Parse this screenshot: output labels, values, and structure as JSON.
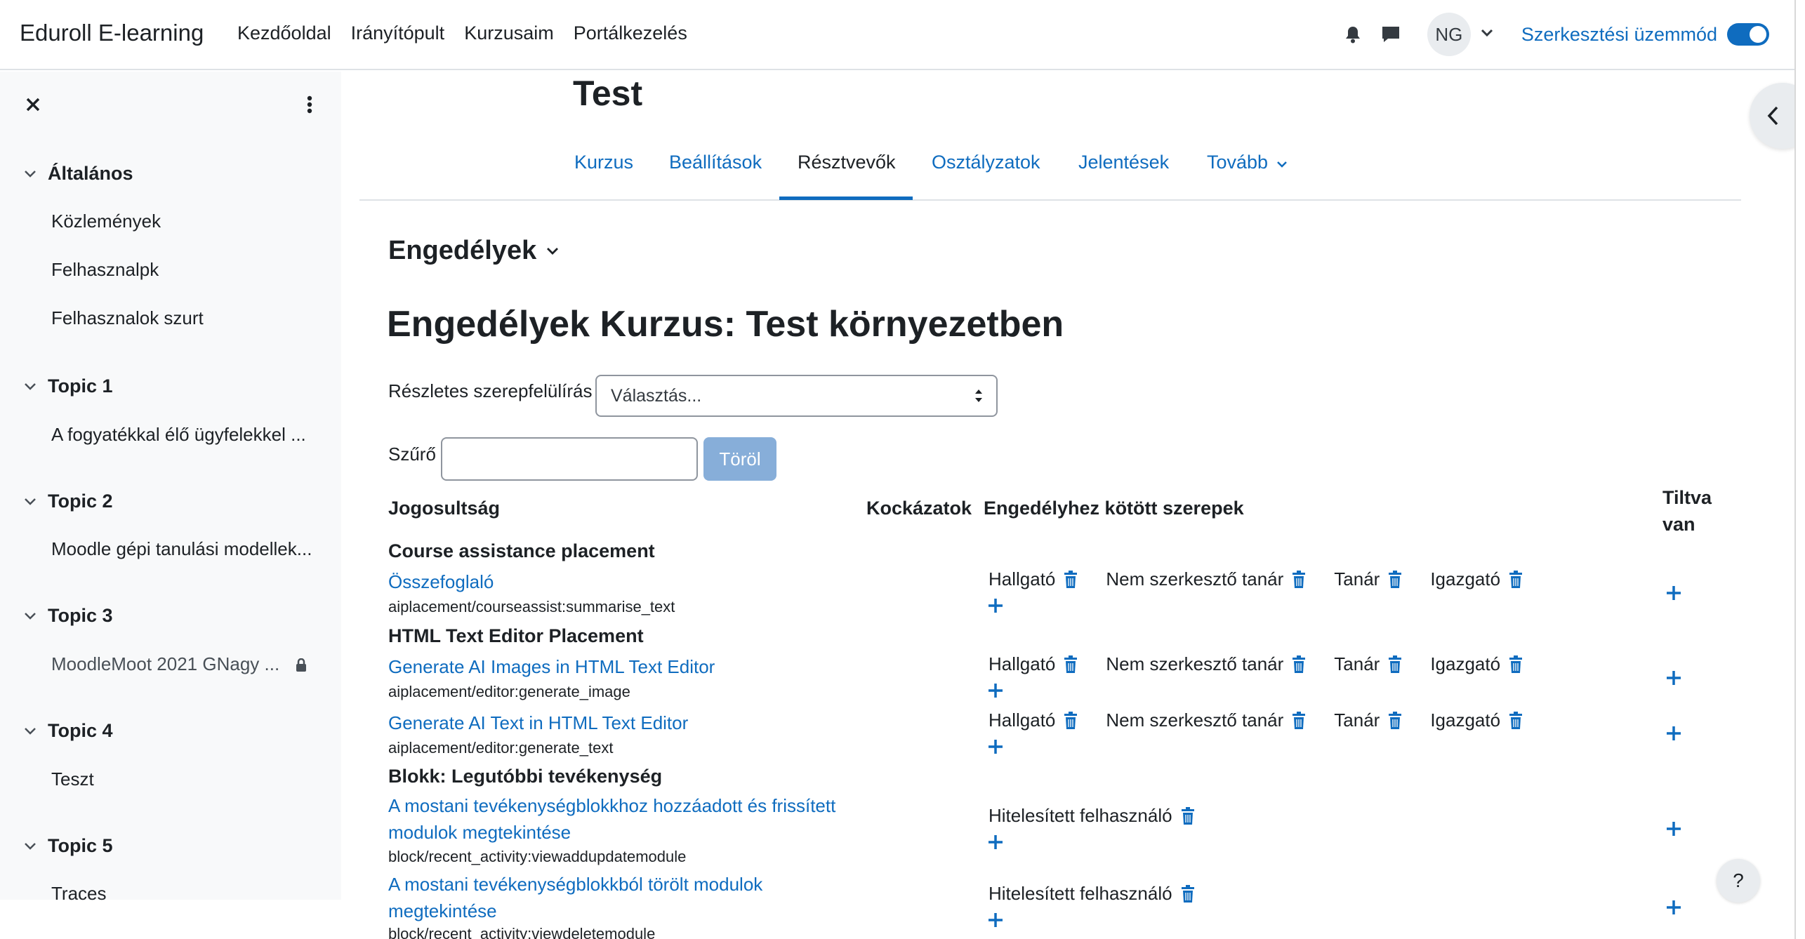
{
  "navbar": {
    "brand": "Eduroll E-learning",
    "links": [
      "Kezdőoldal",
      "Irányítópult",
      "Kurzusaim",
      "Portálkezelés"
    ],
    "user_initials": "NG",
    "edit_mode_label": "Szerkesztési üzemmód",
    "edit_mode_on": true
  },
  "drawer": {
    "sections": [
      {
        "title": "Általános",
        "items": [
          "Közlemények",
          "Felhasznalpk",
          "Felhasznalok szurt"
        ]
      },
      {
        "title": "Topic 1",
        "items": [
          "A fogyatékkal élő ügyfelekkel ..."
        ]
      },
      {
        "title": "Topic 2",
        "items": [
          "Moodle gépi tanulási modellek..."
        ]
      },
      {
        "title": "Topic 3",
        "items": [
          "MoodleMoot 2021 GNagy ..."
        ]
      },
      {
        "title": "Topic 4",
        "items": [
          "Teszt"
        ]
      },
      {
        "title": "Topic 5",
        "items": [
          "Traces"
        ]
      }
    ]
  },
  "course": {
    "title": "Test",
    "tabs": [
      "Kurzus",
      "Beállítások",
      "Résztvevők",
      "Osztályzatok",
      "Jelentések",
      "Tovább"
    ],
    "active_tab": "Résztvevők"
  },
  "permissions": {
    "menu_title": "Engedélyek",
    "heading": "Engedélyek Kurzus: Test környezetben",
    "advanced_override_label": "Részletes szerepfelülírás",
    "select_value": "Választás...",
    "filter_label": "Szűrő",
    "clear_button": "Töröl",
    "columns": {
      "capability": "Jogosultság",
      "risks": "Kockázatok",
      "roles": "Engedélyhez kötött szerepek",
      "prohibited_line1": "Tiltva",
      "prohibited_line2": "van"
    },
    "groups": [
      {
        "name": "Course assistance placement"
      },
      {
        "name": "HTML Text Editor Placement"
      },
      {
        "name": "Blokk: Legutóbbi tevékenység"
      }
    ],
    "rows": [
      {
        "title": "Összefoglaló",
        "code": "aiplacement/courseassist:summarise_text",
        "roles": [
          "Hallgató",
          "Nem szerkesztő tanár",
          "Tanár",
          "Igazgató"
        ]
      },
      {
        "title": "Generate AI Images in HTML Text Editor",
        "code": "aiplacement/editor:generate_image",
        "roles": [
          "Hallgató",
          "Nem szerkesztő tanár",
          "Tanár",
          "Igazgató"
        ]
      },
      {
        "title": "Generate AI Text in HTML Text Editor",
        "code": "aiplacement/editor:generate_text",
        "roles": [
          "Hallgató",
          "Nem szerkesztő tanár",
          "Tanár",
          "Igazgató"
        ]
      },
      {
        "title": "A mostani tevékenységblokkhoz hozzáadott és frissített modulok megtekintése",
        "code": "block/recent_activity:viewaddupdatemodule",
        "roles": [
          "Hitelesített felhasználó"
        ]
      },
      {
        "title": "A mostani tevékenységblokkból törölt modulok megtekintése",
        "code": "block/recent_activity:viewdeletemodule",
        "roles": [
          "Hitelesített felhasználó"
        ]
      }
    ]
  },
  "help_label": "?",
  "colors": {
    "link": "#0f6cbf",
    "drawer_bg": "#f8f9fa",
    "button_disabled": "#87aed9"
  }
}
